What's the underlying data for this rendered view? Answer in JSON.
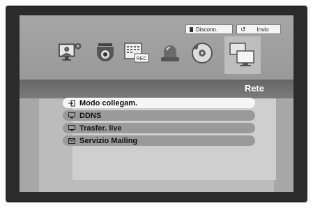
{
  "header": {
    "disconnect_label": "Disconn.",
    "send_label": "Invio"
  },
  "icons": [
    {
      "name": "system-setup-icon"
    },
    {
      "name": "camera-setup-icon"
    },
    {
      "name": "record-schedule-icon",
      "badge": "REC"
    },
    {
      "name": "event-alarm-icon"
    },
    {
      "name": "backup-disc-icon"
    },
    {
      "name": "network-setup-icon",
      "active": true
    }
  ],
  "page": {
    "title": "Rete"
  },
  "menu": {
    "items": [
      {
        "label": "Modo collegam.",
        "icon": "login-icon",
        "selected": true
      },
      {
        "label": "DDNS",
        "icon": "monitor-icon"
      },
      {
        "label": "Trasfer. live",
        "icon": "monitor-icon"
      },
      {
        "label": "Servizio Mailing",
        "icon": "mail-icon"
      }
    ]
  },
  "colors": {
    "frame": "#2b2b2b",
    "selected_item": "#f6f6f6",
    "item": "#9a9a9a"
  }
}
